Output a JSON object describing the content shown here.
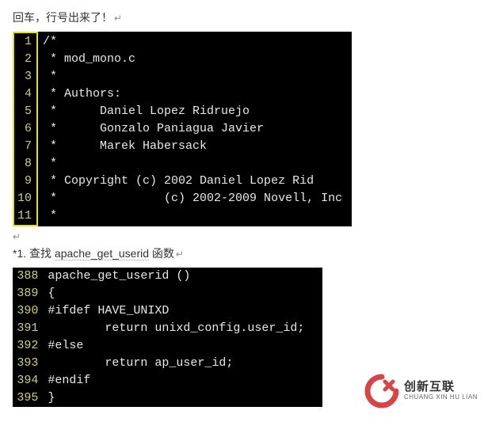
{
  "text": {
    "line1": "回车，行号出来了！",
    "crlf": "↵",
    "paragraph_break": "↵",
    "line2_prefix": "*1. 查找 ",
    "line2_func": "apache_get_userid",
    "line2_suffix": " 函数"
  },
  "code1": {
    "line_numbers": [
      "1",
      "2",
      "3",
      "4",
      "5",
      "6",
      "7",
      "8",
      "9",
      "10",
      "11"
    ],
    "lines": [
      "/*",
      " * mod_mono.c",
      " *",
      " * Authors:",
      " *      Daniel Lopez Ridruejo",
      " *      Gonzalo Paniagua Javier",
      " *      Marek Habersack",
      " *",
      " * Copyright (c) 2002 Daniel Lopez Rid",
      " *               (c) 2002-2009 Novell, Inc",
      " *"
    ]
  },
  "code2": {
    "line_numbers": [
      "388",
      "389",
      "390",
      "391",
      "392",
      "393",
      "394",
      "395"
    ],
    "lines": [
      "apache_get_userid ()",
      "{",
      "#ifdef HAVE_UNIXD",
      "        return unixd_config.user_id;",
      "#else",
      "        return ap_user_id;",
      "#endif",
      "}"
    ]
  },
  "logo": {
    "cn": "创新互联",
    "py": "CHUANG XIN HU LIAN"
  }
}
